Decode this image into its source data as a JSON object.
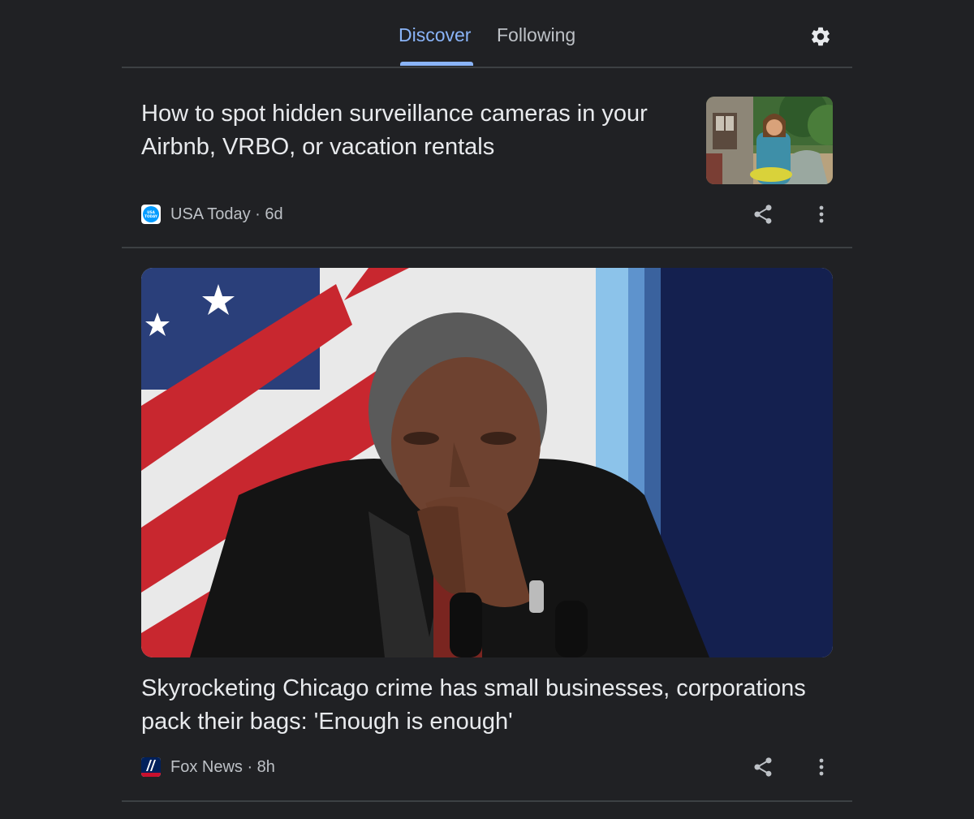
{
  "tabs": {
    "discover": "Discover",
    "following": "Following",
    "active": "Discover"
  },
  "colors": {
    "background": "#202124",
    "accent": "#8ab4f8",
    "text": "#e8eaed",
    "secondary_text": "#bdc1c6",
    "divider": "#3c4043"
  },
  "icons": {
    "settings": "gear-icon",
    "share": "share-icon",
    "more": "more-vert-icon"
  },
  "articles": [
    {
      "headline": "How to spot hidden surveillance cameras in your Airbnb, VRBO, or vacation rentals",
      "source": "USA Today",
      "age": "6d",
      "meta": "USA Today · 6d",
      "logo_text": "USA TODAY",
      "image": "thumbnail photo: smiling woman in a denim jacket holding a yellow bag outside a stone cottage"
    },
    {
      "headline": "Skyrocketing Chicago crime has small businesses, corporations pack their bags: 'Enough is enough'",
      "source": "Fox News",
      "age": "8h",
      "meta": "Fox News · 8h",
      "image": "large photo: woman in a dark blazer looking down at a podium with microphones, U.S. flag and blue flag behind"
    }
  ]
}
